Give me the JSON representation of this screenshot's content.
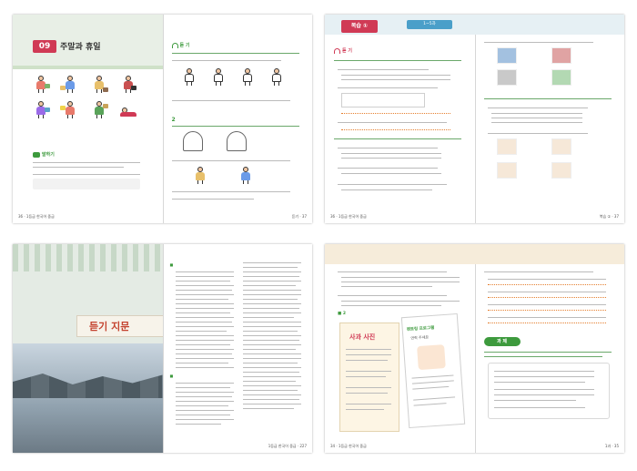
{
  "spread1": {
    "lesson_number": "09",
    "lesson_title": "주말과 휴일",
    "left_footer": "36 · 1등급 한국어 중급",
    "right_footer": "듣기 · 37",
    "listen_heading": "듣 기",
    "speak_heading": "말하기",
    "colors": {
      "accent": "#d03a55",
      "green": "#3d9a3d",
      "blue": "#1f5f9e"
    }
  },
  "spread2": {
    "review_tab": "복습 ①",
    "chapter_tab": "1~5과",
    "listen_heading": "듣 기",
    "left_footer": "36 · 1등급 한국어 중급",
    "right_footer": "복습 ① · 37",
    "choice_label": "1"
  },
  "spread3": {
    "title": "듣기 지문",
    "footer": "1등급 한국어 중급 · 227"
  },
  "spread4": {
    "left_footer": "34 · 1등급 한국어 중급",
    "right_footer": "1과 · 35",
    "task_heading": "과 제",
    "card_title": "사과 사진",
    "card_title2": "멘토링 프로그램",
    "card_sub": "연락 주세요"
  }
}
